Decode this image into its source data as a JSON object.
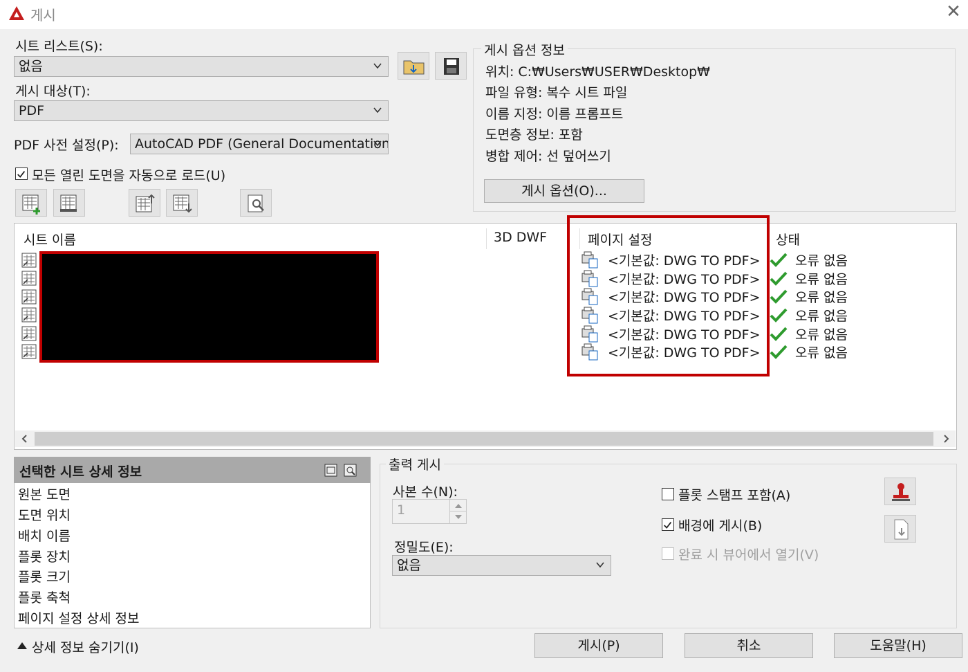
{
  "window": {
    "title": "게시"
  },
  "sheet_list": {
    "label": "시트 리스트(S):",
    "value": "없음"
  },
  "publish_to": {
    "label": "게시 대상(T):",
    "value": "PDF"
  },
  "pdf_preset": {
    "label": "PDF 사전 설정(P):",
    "value": "AutoCAD PDF (General Documentation"
  },
  "auto_load": {
    "label": "모든 열린 도면을 자동으로 로드(U)",
    "checked": true
  },
  "publish_options": {
    "title": "게시 옵션 정보",
    "lines": [
      "위치: C:₩Users₩USER₩Desktop₩",
      "파일 유형: 복수 시트 파일",
      "이름 지정: 이름 프롬프트",
      "도면층 정보: 포함",
      "병합 제어: 선 덮어쓰기"
    ],
    "button": "게시 옵션(O)..."
  },
  "sheet_table": {
    "columns": [
      "시트 이름",
      "3D DWF",
      "페이지 설정",
      "상태"
    ],
    "rows": [
      {
        "page_setup": "<기본값: DWG TO PDF>",
        "status": "오류 없음"
      },
      {
        "page_setup": "<기본값: DWG TO PDF>",
        "status": "오류 없음"
      },
      {
        "page_setup": "<기본값: DWG TO PDF>",
        "status": "오류 없음"
      },
      {
        "page_setup": "<기본값: DWG TO PDF>",
        "status": "오류 없음"
      },
      {
        "page_setup": "<기본값: DWG TO PDF>",
        "status": "오류 없음"
      },
      {
        "page_setup": "<기본값: DWG TO PDF>",
        "status": "오류 없음"
      }
    ]
  },
  "details": {
    "title": "선택한 시트 상세 정보",
    "items": [
      "원본 도면",
      "도면 위치",
      "배치 이름",
      "플롯 장치",
      "플롯 크기",
      "플롯 축척",
      "페이지 설정 상세 정보"
    ],
    "hide_label": "상세 정보 숨기기(I)"
  },
  "output": {
    "title": "출력 게시",
    "copies_label": "사본 수(N):",
    "copies_value": "1",
    "precision_label": "정밀도(E):",
    "precision_value": "없음",
    "plot_stamp": {
      "label": "플롯 스탬프 포함(A)",
      "checked": false
    },
    "background": {
      "label": "배경에 게시(B)",
      "checked": true
    },
    "open_viewer": {
      "label": "완료 시 뷰어에서 열기(V)",
      "checked": false
    }
  },
  "buttons": {
    "publish": "게시(P)",
    "cancel": "취소",
    "help": "도움말(H)"
  },
  "colors": {
    "highlight": "#c00000",
    "check": "#2e9b2e",
    "accent_icon": "#1565c0"
  }
}
